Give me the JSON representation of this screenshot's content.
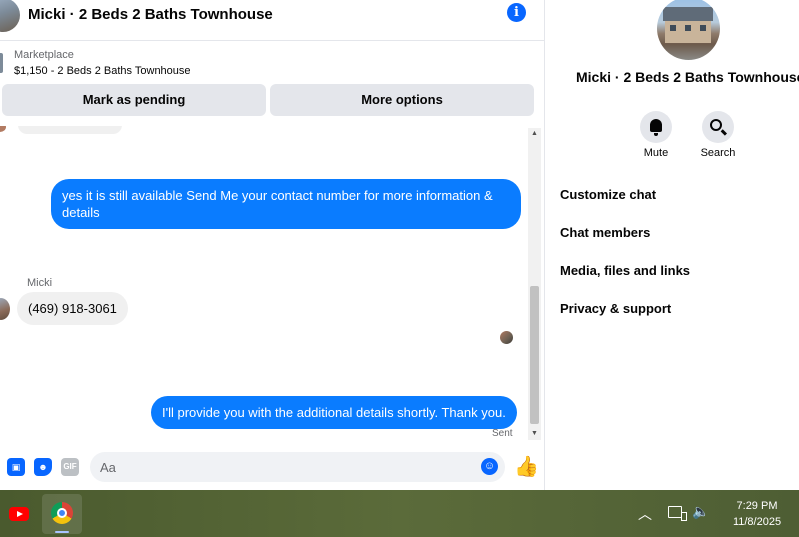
{
  "chat": {
    "title": "Micki · 2 Beds 2 Baths Townhouse",
    "listing": {
      "source": "Marketplace",
      "price_title": "$1,150 - 2 Beds 2 Baths Townhouse"
    },
    "buttons": {
      "pending": "Mark as pending",
      "more": "More options"
    },
    "messages": [
      {
        "text": "yes it is still available Send Me your contact number for more information & details"
      },
      {
        "sender": "Micki",
        "text": "(469) 918-3061"
      },
      {
        "text": "I'll provide you with the additional details shortly. Thank you.",
        "status": "Sent"
      }
    ],
    "composer": {
      "placeholder": "Aa",
      "gif_label": "GIF"
    }
  },
  "info_panel": {
    "name": "Micki · 2 Beds 2 Baths Townhouse",
    "actions": {
      "mute": "Mute",
      "search": "Search"
    },
    "menu": [
      "Customize chat",
      "Chat members",
      "Media, files and links",
      "Privacy & support"
    ]
  },
  "taskbar": {
    "time": "7:29 PM",
    "date": "11/8/2025"
  },
  "colors": {
    "accent": "#0866ff",
    "outgoing_bubble": "#0a7cff",
    "incoming_bubble": "#f0f0f0"
  }
}
